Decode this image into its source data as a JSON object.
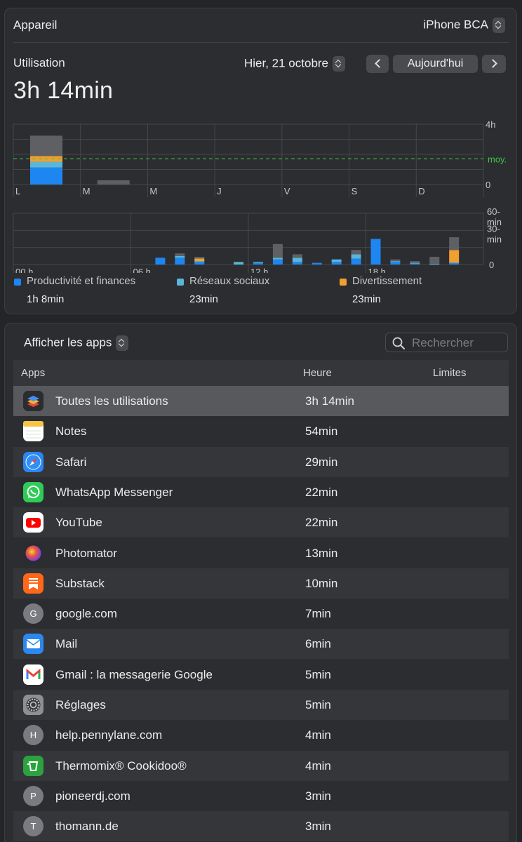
{
  "device": {
    "label": "Appareil",
    "selected": "iPhone BCA"
  },
  "usage": {
    "label": "Utilisation",
    "date": "Hier, 21 octobre",
    "today_label": "Aujourd'hui",
    "total": "3h 14min"
  },
  "chart_data": [
    {
      "type": "bar",
      "title": "",
      "categories": [
        "L",
        "M",
        "M",
        "J",
        "V",
        "S",
        "D"
      ],
      "y_ticks": [
        "4h",
        "0"
      ],
      "ylim": [
        0,
        4
      ],
      "average_label": "moy.",
      "average": 1.7,
      "series": [
        {
          "name": "Productivité et finances",
          "color": "#1e86f0",
          "values": [
            1.13,
            0,
            0,
            0,
            0,
            0,
            0
          ]
        },
        {
          "name": "Réseaux sociaux",
          "color": "#5ab6d8",
          "values": [
            0.38,
            0,
            0,
            0,
            0,
            0,
            0
          ]
        },
        {
          "name": "Divertissement",
          "color": "#f0a030",
          "values": [
            0.38,
            0,
            0,
            0,
            0,
            0,
            0
          ]
        },
        {
          "color": "#5f6064",
          "values": [
            1.35,
            0.28,
            0,
            0,
            0,
            0,
            0
          ]
        }
      ]
    },
    {
      "type": "bar",
      "title": "",
      "x_ticks": [
        "00 h",
        "06 h",
        "12 h",
        "18 h"
      ],
      "y_ticks": [
        "60-\nmin",
        "30-\nmin",
        "0"
      ],
      "ylim": [
        0,
        60
      ],
      "hours": [
        7,
        8,
        9,
        11,
        12,
        13,
        14,
        15,
        16,
        17,
        18,
        19,
        20,
        21,
        22
      ],
      "series": [
        {
          "name": "Productivité et finances",
          "color": "#1e86f0",
          "values": [
            8,
            8,
            3,
            0,
            2,
            6,
            3,
            2,
            3,
            7,
            30,
            3,
            1,
            0,
            2
          ]
        },
        {
          "name": "Réseaux sociaux",
          "color": "#5ab6d8",
          "values": [
            0,
            2,
            1,
            3,
            1,
            2,
            5,
            0,
            3,
            5,
            0,
            1,
            1,
            1,
            0
          ]
        },
        {
          "name": "Divertissement",
          "color": "#f0a030",
          "values": [
            0,
            0,
            3,
            0,
            0,
            0,
            0,
            0,
            0,
            0,
            0,
            0,
            0,
            0,
            15
          ]
        },
        {
          "color": "#5f6064",
          "values": [
            0,
            3,
            2,
            0,
            0,
            16,
            4,
            0,
            0,
            5,
            0,
            2,
            2,
            8,
            15
          ]
        }
      ]
    }
  ],
  "legend": [
    {
      "label": "Productivité et finances",
      "value": "1h 8min",
      "color": "#1e86f0"
    },
    {
      "label": "Réseaux sociaux",
      "value": "23min",
      "color": "#5ab6d8"
    },
    {
      "label": "Divertissement",
      "value": "23min",
      "color": "#f0a030"
    }
  ],
  "list": {
    "filter": "Afficher les apps",
    "search_placeholder": "Rechercher",
    "columns": {
      "apps": "Apps",
      "time": "Heure",
      "limits": "Limites"
    },
    "rows": [
      {
        "name": "Toutes les utilisations",
        "time": "3h 14min",
        "icon": "stack-icon"
      },
      {
        "name": "Notes",
        "time": "54min",
        "icon": "notes-icon"
      },
      {
        "name": "Safari",
        "time": "29min",
        "icon": "safari-icon"
      },
      {
        "name": "WhatsApp Messenger",
        "time": "22min",
        "icon": "whatsapp-icon"
      },
      {
        "name": "YouTube",
        "time": "22min",
        "icon": "youtube-icon"
      },
      {
        "name": "Photomator",
        "time": "13min",
        "icon": "photomator-icon"
      },
      {
        "name": "Substack",
        "time": "10min",
        "icon": "substack-icon"
      },
      {
        "name": "google.com",
        "time": "7min",
        "icon": "web-icon",
        "letter": "G"
      },
      {
        "name": "Mail",
        "time": "6min",
        "icon": "mail-icon"
      },
      {
        "name": "Gmail : la messagerie Google",
        "time": "5min",
        "icon": "gmail-icon"
      },
      {
        "name": "Réglages",
        "time": "5min",
        "icon": "settings-icon"
      },
      {
        "name": "help.pennylane.com",
        "time": "4min",
        "icon": "web-icon",
        "letter": "H"
      },
      {
        "name": "Thermomix® Cookidoo®",
        "time": "4min",
        "icon": "thermomix-icon"
      },
      {
        "name": "pioneerdj.com",
        "time": "3min",
        "icon": "web-icon",
        "letter": "P"
      },
      {
        "name": "thomann.de",
        "time": "3min",
        "icon": "web-icon",
        "letter": "T"
      }
    ]
  }
}
